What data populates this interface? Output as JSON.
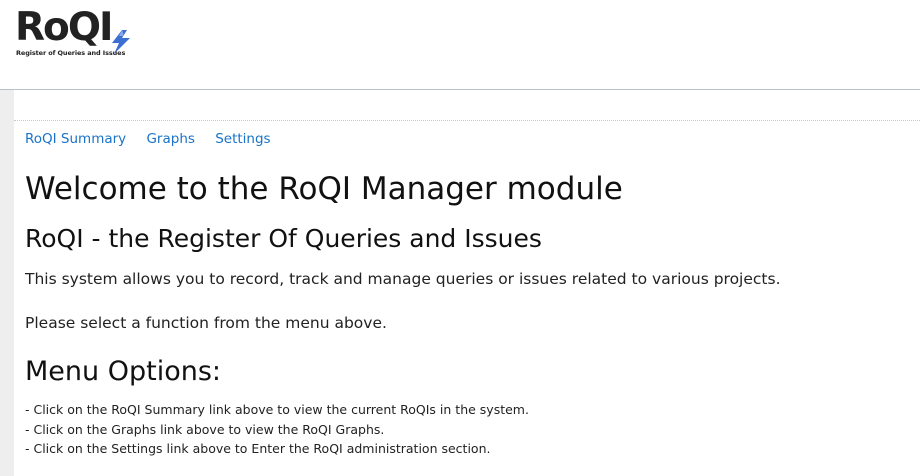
{
  "logo": {
    "word": "RoQI",
    "tagline": "Register of Queries and Issues",
    "bolt_color": "#3b6fd1"
  },
  "nav": {
    "summary": "RoQI Summary",
    "graphs": "Graphs",
    "settings": "Settings"
  },
  "main": {
    "title": "Welcome to the RoQI Manager module",
    "subtitle": "RoQI - the Register Of Queries and Issues",
    "intro": "This system allows you to record, track and manage queries or issues related to various projects.",
    "prompt": "Please select a function from the menu above.",
    "menu_heading": "Menu Options:",
    "options": [
      "- Click on the RoQI Summary link above to view the current RoQIs in the system.",
      "- Click on the Graphs link above to view the RoQI Graphs.",
      "- Click on the Settings link above to Enter the RoQI administration section."
    ]
  },
  "colors": {
    "link": "#1a73c8",
    "header_border": "#b9c3c7",
    "side_strip": "#eeeeee"
  }
}
